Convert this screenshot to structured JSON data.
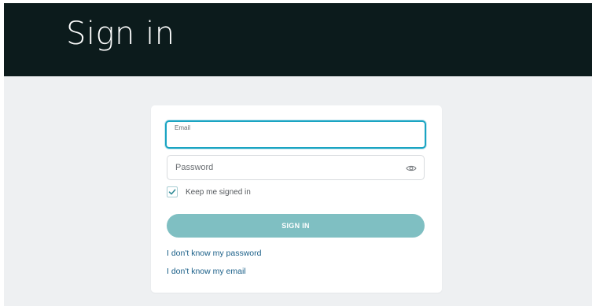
{
  "colors": {
    "header_bg": "#0c1b1c",
    "page_bg": "#eef0f2",
    "accent": "#1aa4c2",
    "button_bg": "#7fbfc2",
    "link": "#1a5f88",
    "check": "#2f8a96"
  },
  "header": {
    "title": "Sign in"
  },
  "form": {
    "email": {
      "label": "Email",
      "value": ""
    },
    "password": {
      "placeholder": "Password",
      "toggle_icon": "eye-icon"
    },
    "keep_signed_in": {
      "label": "Keep me signed in",
      "checked": true
    },
    "submit_label": "SIGN IN",
    "links": {
      "forgot_password": "I don't know my password",
      "forgot_email": "I don't know my email"
    }
  }
}
